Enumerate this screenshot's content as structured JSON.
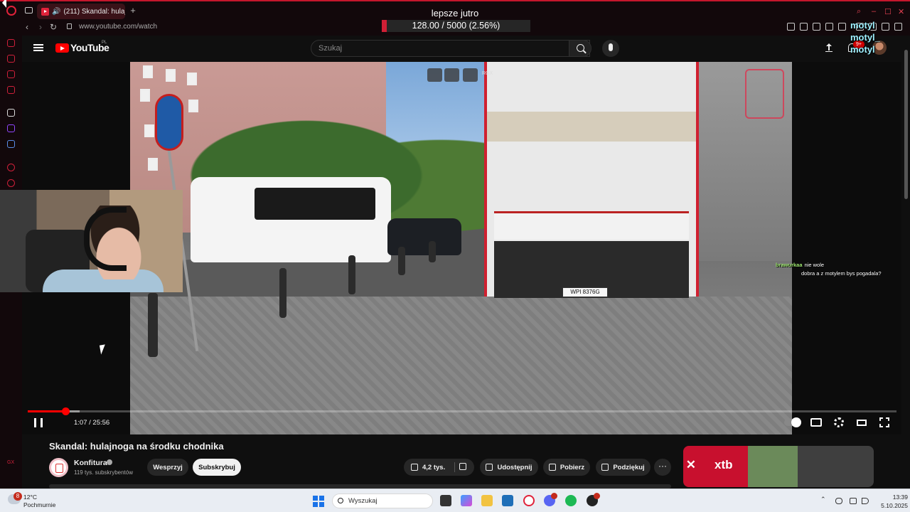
{
  "browser": {
    "tab_title": "(211) Skandal: hulajnog",
    "url": "www.youtube.com/watch"
  },
  "overlay": {
    "goal_title": "lepsze jutro",
    "goal_text": "128.00 / 5000 (2.56%)",
    "goal_fraction": 0.0256,
    "usernames": [
      "motyl",
      "motyl_",
      "motyl"
    ],
    "accent_color": "#d01f35"
  },
  "youtube": {
    "logo_text": "YouTube",
    "region": "PL",
    "search_placeholder": "Szukaj",
    "notification_count": "9+"
  },
  "player": {
    "time": "1:07 / 25:56",
    "played_fraction": 0.043,
    "buffered_fraction": 0.06,
    "ext_label": "RGX",
    "plate": "WPI 8376G"
  },
  "chat": [
    {
      "user": "brawurkaa",
      "user_color": "#9fe870",
      "message": "nie wole"
    },
    {
      "user": "",
      "user_color": "#e05050",
      "message": "dobra a z motylem bys pogadala?"
    }
  ],
  "video": {
    "title": "Skandal: hulajnoga na środku chodnika",
    "channel_name": "Konfitura",
    "subscribers": "119 tys. subskrybentów",
    "support_label": "Wesprzyj",
    "subscribe_label": "Subskrybuj",
    "likes": "4,2 tys.",
    "share_label": "Udostępnij",
    "download_label": "Pobierz",
    "thanks_label": "Podziękuj",
    "more_label": "···"
  },
  "ad": {
    "brand": "xtb"
  },
  "taskbar": {
    "weather_temp": "12°C",
    "weather_desc": "Pochmurnie",
    "weather_badge": "8",
    "search_placeholder": "Wyszukaj",
    "time": "13:39",
    "date": "5.10.2025"
  }
}
